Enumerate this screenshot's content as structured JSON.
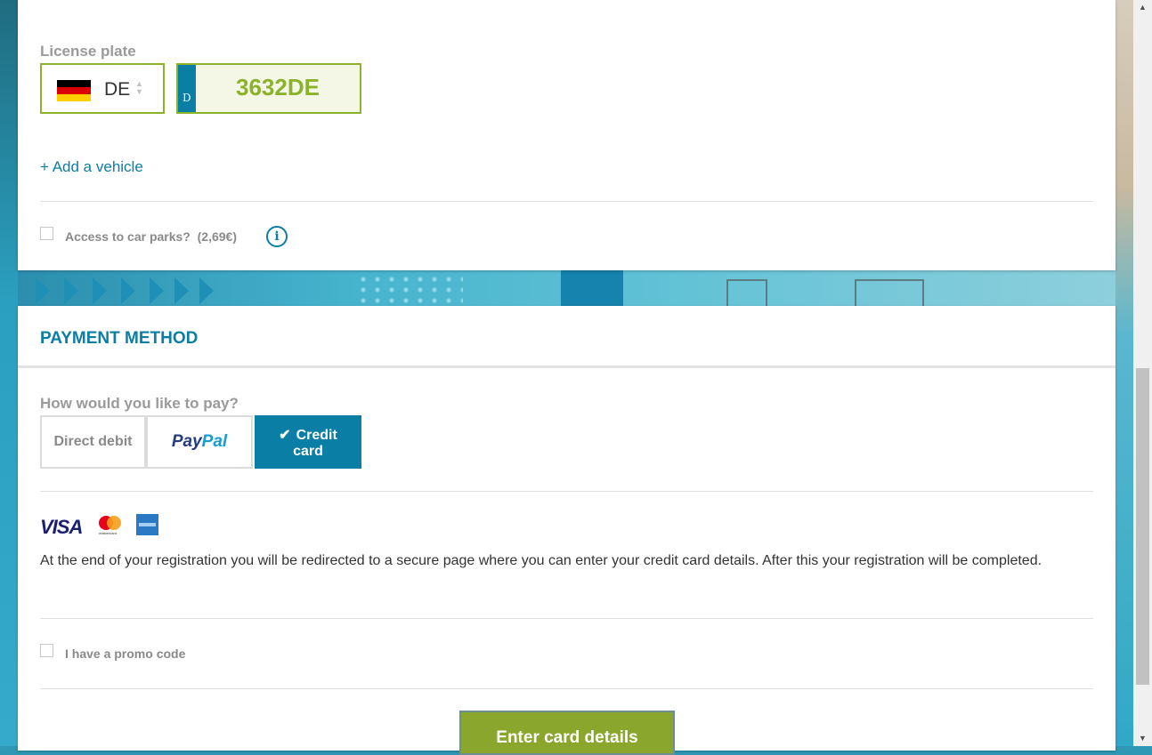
{
  "vehicle": {
    "license_plate_label": "License plate",
    "country_code": "DE",
    "plate_prefix": "D",
    "plate_number": "3632DE",
    "add_vehicle_link": "+ Add a vehicle",
    "car_park_access_label": "Access to car parks?",
    "car_park_access_price": "(2,69€)"
  },
  "payment": {
    "section_title": "PAYMENT METHOD",
    "question": "How would you like to pay?",
    "options": [
      {
        "label": "Direct debit",
        "selected": false
      },
      {
        "label": "PayPal",
        "selected": false
      },
      {
        "label": "Credit card",
        "selected": true
      }
    ],
    "paypal_logo_part1": "Pay",
    "paypal_logo_part2": "Pal",
    "credit_line1": "Credit",
    "credit_line2": "card",
    "card_brands": [
      "VISA",
      "mastercard",
      "American Express"
    ],
    "visa_text": "VISA",
    "mastercard_text": "mastercard",
    "redirect_text": "At the end of your registration you will be redirected to a secure page where you can enter your credit card details. After this your registration will be completed.",
    "promo_label": "I have a promo code",
    "submit_label": "Enter card details"
  },
  "colors": {
    "accent_blue": "#0a7ea4",
    "accent_green": "#8cb22a",
    "button_green": "#8ba62c"
  },
  "icons": {
    "info": "info-icon",
    "check": "checkmark-icon",
    "flag": "germany-flag-icon",
    "spinner": "select-arrows-icon"
  }
}
